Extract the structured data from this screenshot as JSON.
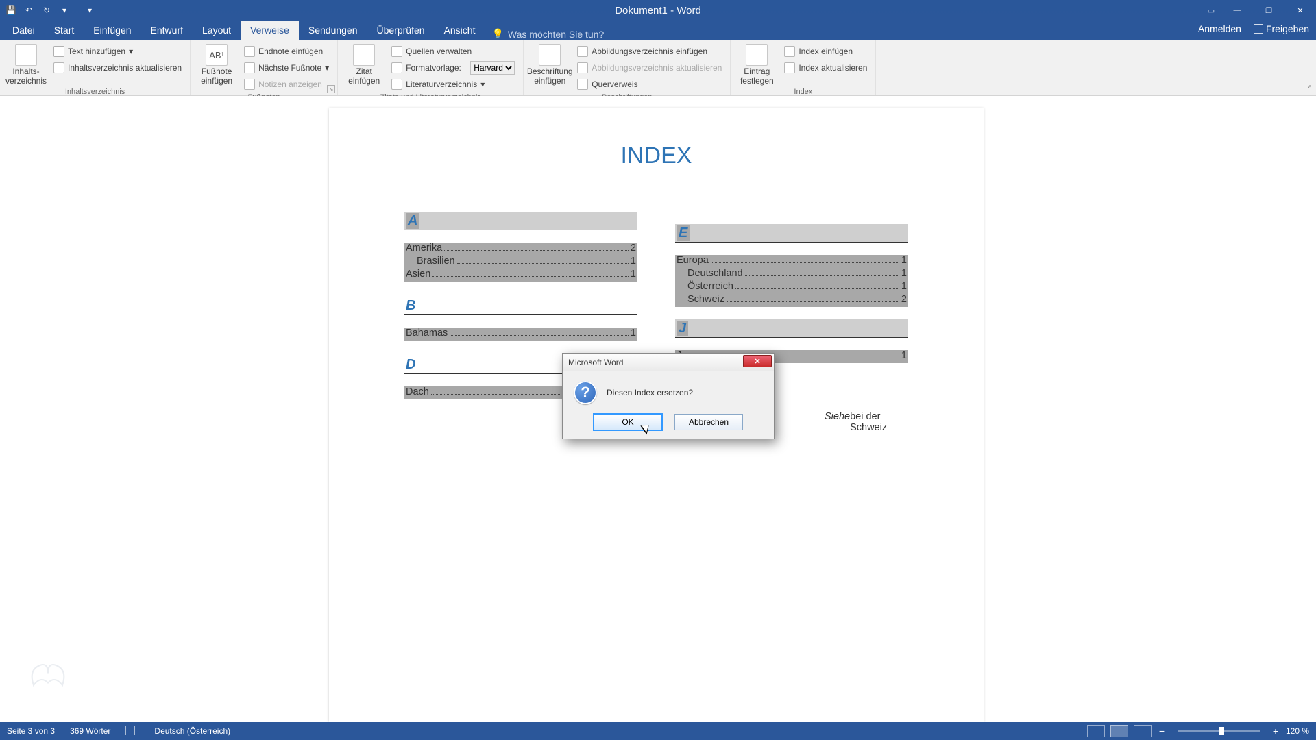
{
  "title": "Dokument1 - Word",
  "qat": {
    "save": "",
    "undo": "↶",
    "redo": "↻",
    "touch": ""
  },
  "wincmds": {
    "ribbonopts": "▭",
    "min": "—",
    "restore": "❐",
    "close": "✕"
  },
  "tabs": {
    "datei": "Datei",
    "start": "Start",
    "einfuegen": "Einfügen",
    "entwurf": "Entwurf",
    "layout": "Layout",
    "verweise": "Verweise",
    "sendungen": "Sendungen",
    "ueberpruefen": "Überprüfen",
    "ansicht": "Ansicht"
  },
  "tellme": "Was möchten Sie tun?",
  "topright": {
    "anmelden": "Anmelden",
    "freigeben": "Freigeben"
  },
  "ribbon": {
    "toc": {
      "big": "Inhalts-\nverzeichnis",
      "add": "Text hinzufügen",
      "update": "Inhaltsverzeichnis aktualisieren",
      "group": "Inhaltsverzeichnis"
    },
    "fn": {
      "big": "Fußnote\neinfügen",
      "sup": "AB¹",
      "end": "Endnote einfügen",
      "next": "Nächste Fußnote",
      "show": "Notizen anzeigen",
      "group": "Fußnoten"
    },
    "cit": {
      "big": "Zitat\neinfügen",
      "src": "Quellen verwalten",
      "style_lbl": "Formatvorlage:",
      "style_val": "Harvard",
      "bib": "Literaturverzeichnis",
      "group": "Zitate und Literaturverzeichnis"
    },
    "cap": {
      "big": "Beschriftung\neinfügen",
      "ins": "Abbildungsverzeichnis einfügen",
      "upd": "Abbildungsverzeichnis aktualisieren",
      "xref": "Querverweis",
      "group": "Beschriftungen"
    },
    "idx": {
      "big": "Eintrag\nfestlegen",
      "ins": "Index einfügen",
      "upd": "Index aktualisieren",
      "group": "Index"
    }
  },
  "doch1": "INDEX",
  "letters": {
    "A": "A",
    "B": "B",
    "D": "D",
    "E": "E",
    "J": "J"
  },
  "entries": {
    "amerika": {
      "n": "Amerika",
      "p": "2"
    },
    "brasilien": {
      "n": "Brasilien",
      "p": "1"
    },
    "asien": {
      "n": "Asien",
      "p": "1"
    },
    "bahamas": {
      "n": "Bahamas",
      "p": "1"
    },
    "dach": {
      "n": "Dach",
      "p": ""
    },
    "europa": {
      "n": "Europa",
      "p": "1"
    },
    "deutschland": {
      "n": "Deutschland",
      "p": "1"
    },
    "oesterreich": {
      "n": "Österreich",
      "p": "1"
    },
    "schweiz": {
      "n": "Schweiz",
      "p": "2"
    },
    "japan": {
      "n": "Japan",
      "p": "1"
    },
    "siehe_lbl": "Siehe ",
    "siehe_txt": "bei der Schweiz"
  },
  "dialog": {
    "title": "Microsoft Word",
    "msg": "Diesen Index ersetzen?",
    "ok": "OK",
    "cancel": "Abbrechen"
  },
  "status": {
    "page": "Seite 3 von 3",
    "words": "369 Wörter",
    "lang": "Deutsch (Österreich)",
    "zoom": "120 %"
  }
}
